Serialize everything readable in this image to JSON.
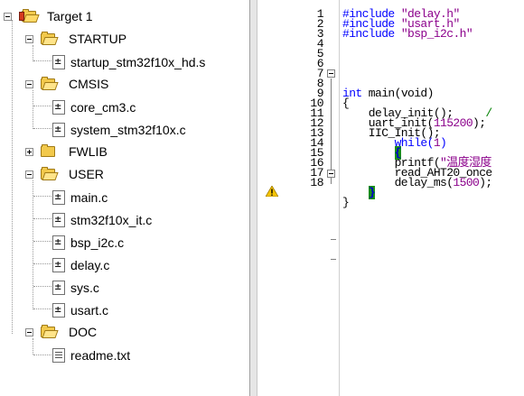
{
  "tree": {
    "root": "Target 1",
    "groups": [
      {
        "name": "STARTUP",
        "expanded": true,
        "files": [
          "startup_stm32f10x_hd.s"
        ]
      },
      {
        "name": "CMSIS",
        "expanded": true,
        "files": [
          "core_cm3.c",
          "system_stm32f10x.c"
        ]
      },
      {
        "name": "FWLIB",
        "expanded": false,
        "files": []
      },
      {
        "name": "USER",
        "expanded": true,
        "files": [
          "main.c",
          "stm32f10x_it.c",
          "bsp_i2c.c",
          "delay.c",
          "sys.c",
          "usart.c"
        ]
      },
      {
        "name": "DOC",
        "expanded": true,
        "files": [
          "readme.txt"
        ]
      }
    ]
  },
  "editor": {
    "line_numbers": [
      "1",
      "2",
      "3",
      "4",
      "5",
      "6",
      "7",
      "8",
      "9",
      "10",
      "11",
      "12",
      "13",
      "14",
      "15",
      "16",
      "17",
      "18"
    ],
    "code": {
      "l1_directive": "#include",
      "l1_file": "\"delay.h\"",
      "l2_directive": "#include",
      "l2_file": "\"usart.h\"",
      "l3_directive": "#include",
      "l3_file": "\"bsp_i2c.h\"",
      "l6_type": "int",
      "l6_rest": " main(void)",
      "l7_brace": "{",
      "l8_call": "    delay_init();",
      "l8_comment": "     /",
      "l9_call": "    uart_init(",
      "l9_num": "115200",
      "l9_end": ");",
      "l10_call": "    IIC_Init();",
      "l11_call": "        while(",
      "l11_num": "1",
      "l11_end": ")",
      "l12_brace": "{",
      "l13_call": "        printf(",
      "l13_str": "\"温度湿度",
      "l14_call": "        read_AHT20_once",
      "l15_call": "        delay_ms(",
      "l15_num": "1500",
      "l15_end": ");",
      "l16_brace": "}",
      "l17_brace": "}"
    },
    "warning_line": "13",
    "colors": {
      "keyword": "#0000ff",
      "string": "#8b008b",
      "comment": "#008000",
      "current_line": "#c9f5e3",
      "brace_match": "#1a8f1a"
    }
  },
  "icons": {
    "warning": "warning-icon",
    "folder": "folder-icon",
    "file": "source-file-icon",
    "text_file": "text-file-icon"
  }
}
